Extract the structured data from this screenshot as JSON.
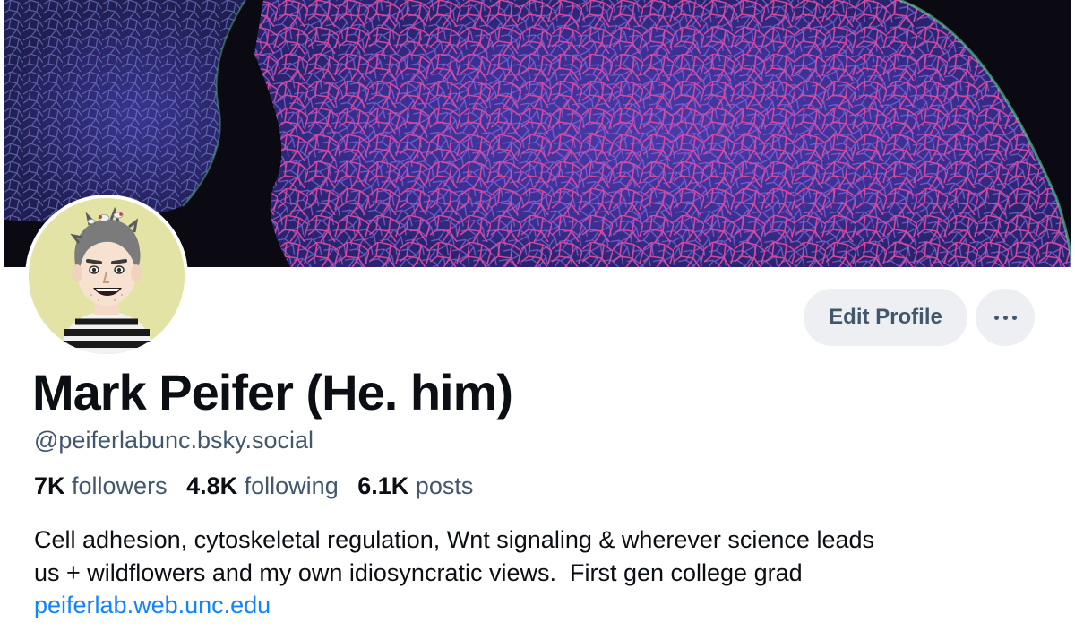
{
  "banner": {
    "alt": "fluorescence microscopy image of epithelial cells with magenta, blue and green cell outlines"
  },
  "avatar": {
    "alt": "cartoon portrait of a man with grey hair and a striped shirt"
  },
  "profile": {
    "display_name": "Mark Peifer (He. him)",
    "handle": "@peiferlabunc.bsky.social",
    "followers_count": "7K",
    "followers_label": "followers",
    "following_count": "4.8K",
    "following_label": "following",
    "posts_count": "6.1K",
    "posts_label": "posts",
    "bio_line1": "Cell adhesion, cytoskeletal regulation, Wnt signaling & wherever science leads",
    "bio_line2": "us + wildflowers and my own idiosyncratic views.  First gen college grad",
    "website": "peiferlab.web.unc.edu"
  },
  "actions": {
    "edit_profile_label": "Edit Profile",
    "more_icon": "ellipsis-icon"
  },
  "colors": {
    "text_primary": "#0b0f14",
    "text_secondary": "#42576c",
    "link": "#1083fe",
    "button_bg": "#edeff2",
    "avatar_bg": "#e3e3a6"
  }
}
